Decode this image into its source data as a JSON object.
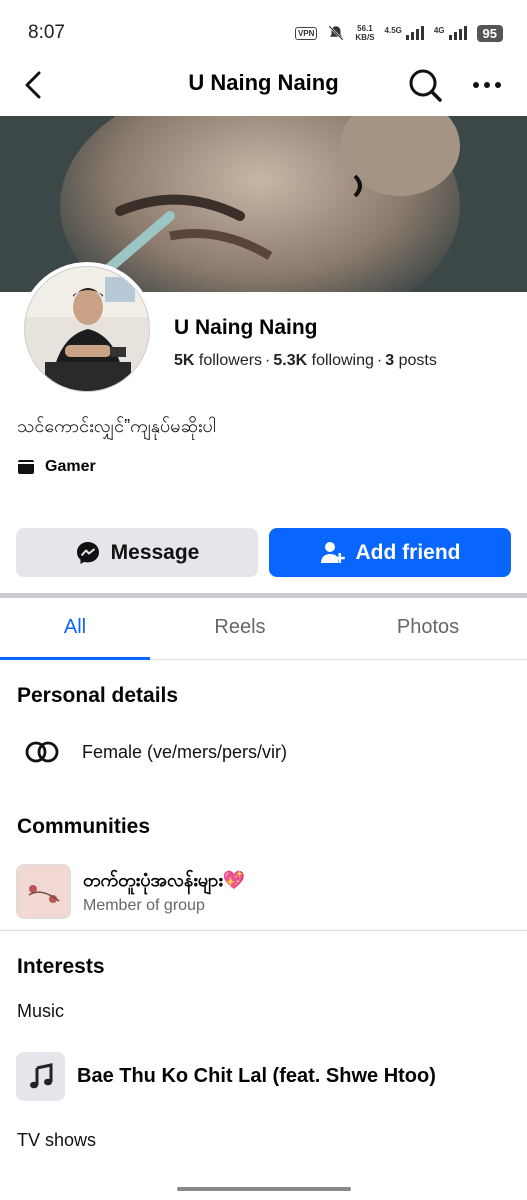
{
  "status_bar": {
    "time": "8:07",
    "vpn": "VPN",
    "speed_value": "56.1",
    "speed_unit": "KB/S",
    "signal1_label": "4.5G",
    "signal2_label": "4G",
    "battery": "95"
  },
  "header": {
    "title": "U Naing Naing",
    "back_icon": "back-arrow-icon",
    "search_icon": "search-icon",
    "more_icon": "more-icon"
  },
  "profile": {
    "name": "U Naing Naing",
    "followers_count": "5K",
    "followers_label": "followers",
    "following_count": "5.3K",
    "following_label": "following",
    "posts_count": "3",
    "posts_label": "posts",
    "separator": "·",
    "bio": "သင်ကောင်းလျှင်”ကျနုပ်မဆိုးပါ",
    "category": "Gamer"
  },
  "actions": {
    "message_label": "Message",
    "add_friend_label": "Add friend"
  },
  "tabs": [
    {
      "label": "All",
      "active": true
    },
    {
      "label": "Reels",
      "active": false
    },
    {
      "label": "Photos",
      "active": false
    }
  ],
  "personal_details": {
    "title": "Personal details",
    "gender": "Female (ve/mers/pers/vir)"
  },
  "communities": {
    "title": "Communities",
    "items": [
      {
        "name": "တက်တူးပုံအလန်းများ💖",
        "subtitle": "Member of group"
      }
    ]
  },
  "interests": {
    "title": "Interests",
    "music_label": "Music",
    "music_item": "Bae Thu Ko Chit Lal (feat. Shwe Htoo)",
    "tv_label": "TV shows"
  },
  "colors": {
    "accent": "#0866ff",
    "secondary_button": "#e4e6eb",
    "muted_text": "#65676b"
  }
}
